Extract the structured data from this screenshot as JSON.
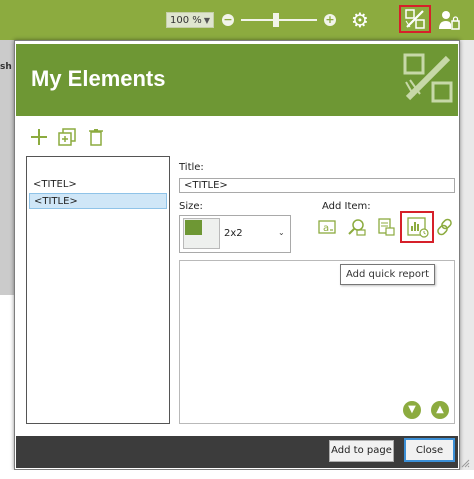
{
  "toolbar": {
    "zoom_value": "100 %",
    "zoom_out_symbol": "−",
    "zoom_in_symbol": "+",
    "zoom_slider_value_percent": 50,
    "icons": [
      "chevron-down-icon",
      "zoom-out-icon",
      "zoom-in-icon",
      "gear-icon",
      "my-elements-icon",
      "user-admin-icon"
    ]
  },
  "background": {
    "left_strip_text": "sh"
  },
  "dialog": {
    "title": "My Elements",
    "toolbar_icons": [
      "add-icon",
      "duplicate-icon",
      "delete-icon"
    ],
    "list": {
      "items": [
        "<TITEL>",
        "<TITLE>"
      ],
      "selected_index": 1
    },
    "form": {
      "title_label": "Title:",
      "title_value": "<TITLE>",
      "size_label": "Size:",
      "size_value": "2x2",
      "add_item_label": "Add Item:",
      "add_item_icons": [
        "text-icon",
        "search-icon",
        "document-icon",
        "quick-report-icon",
        "link-icon"
      ]
    },
    "tooltip": "Add quick report",
    "buttons": {
      "add_to_page": "Add to page",
      "close": "Close"
    }
  },
  "colors": {
    "toolbar_green": "#8cab3f",
    "header_green": "#6e9734",
    "highlight_red": "#d6202a",
    "selection_blue": "#cfe6f7",
    "focus_blue": "#3b8fd6"
  }
}
